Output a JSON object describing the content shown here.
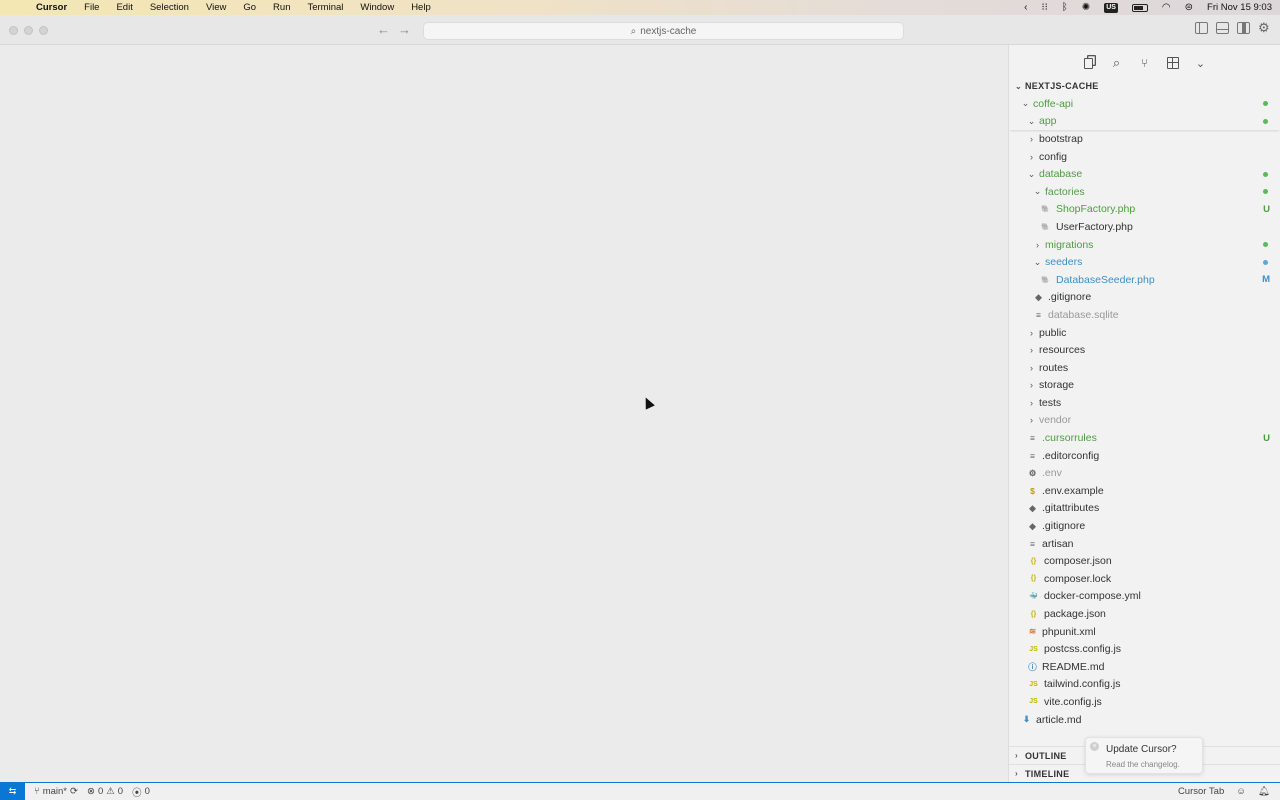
{
  "menubar": {
    "app_name": "Cursor",
    "items": [
      "File",
      "Edit",
      "Selection",
      "View",
      "Go",
      "Run",
      "Terminal",
      "Window",
      "Help"
    ],
    "input_source": "US",
    "datetime": "Fri Nov 15  9:03"
  },
  "titlebar": {
    "search_text": "nextjs-cache"
  },
  "explorer": {
    "workspace": "NEXTJS-CACHE",
    "rows": [
      {
        "label": "coffe-api",
        "depth": 1,
        "twisty": "open",
        "color": "green",
        "dot": "#5cb85c"
      },
      {
        "label": "app",
        "depth": 2,
        "twisty": "open",
        "color": "green",
        "dot": "#5cb85c"
      },
      {
        "label": "bootstrap",
        "depth": 2,
        "twisty": "closed",
        "color": "default"
      },
      {
        "label": "config",
        "depth": 2,
        "twisty": "closed",
        "color": "default"
      },
      {
        "label": "database",
        "depth": 2,
        "twisty": "open",
        "color": "green",
        "dot": "#5cb85c"
      },
      {
        "label": "factories",
        "depth": 3,
        "twisty": "open",
        "color": "green",
        "dot": "#5cb85c"
      },
      {
        "label": "ShopFactory.php",
        "depth": 4,
        "icon": "php-elephant-icon",
        "iconGlyph": "🐘",
        "color": "green",
        "badge": "U",
        "badgeColor": "#4c9e3f"
      },
      {
        "label": "UserFactory.php",
        "depth": 4,
        "icon": "php-elephant-icon",
        "iconGlyph": "🐘",
        "color": "default"
      },
      {
        "label": "migrations",
        "depth": 3,
        "twisty": "closed",
        "color": "green",
        "dot": "#5cb85c"
      },
      {
        "label": "seeders",
        "depth": 3,
        "twisty": "open",
        "color": "blue",
        "dot": "#5aa9d6"
      },
      {
        "label": "DatabaseSeeder.php",
        "depth": 4,
        "icon": "php-elephant-icon",
        "iconGlyph": "🐘",
        "color": "blue",
        "badge": "M",
        "badgeColor": "#3e8ecb"
      },
      {
        "label": ".gitignore",
        "depth": 3,
        "icon": "git-icon",
        "iconGlyph": "◆",
        "color": "default"
      },
      {
        "label": "database.sqlite",
        "depth": 3,
        "icon": "text-file-icon",
        "iconGlyph": "≡",
        "color": "gray"
      },
      {
        "label": "public",
        "depth": 2,
        "twisty": "closed",
        "color": "default"
      },
      {
        "label": "resources",
        "depth": 2,
        "twisty": "closed",
        "color": "default"
      },
      {
        "label": "routes",
        "depth": 2,
        "twisty": "closed",
        "color": "default"
      },
      {
        "label": "storage",
        "depth": 2,
        "twisty": "closed",
        "color": "default"
      },
      {
        "label": "tests",
        "depth": 2,
        "twisty": "closed",
        "color": "default"
      },
      {
        "label": "vendor",
        "depth": 2,
        "twisty": "closed",
        "color": "gray"
      },
      {
        "label": ".cursorrules",
        "depth": 2,
        "icon": "text-file-icon",
        "iconGlyph": "≡",
        "color": "green",
        "badge": "U",
        "badgeColor": "#4c9e3f"
      },
      {
        "label": ".editorconfig",
        "depth": 2,
        "icon": "text-file-icon",
        "iconGlyph": "≡",
        "color": "default"
      },
      {
        "label": ".env",
        "depth": 2,
        "icon": "gear-icon",
        "iconGlyph": "⚙",
        "color": "gray"
      },
      {
        "label": ".env.example",
        "depth": 2,
        "icon": "dollar-icon",
        "iconGlyph": "$",
        "iconColor": "#b8a000",
        "color": "default"
      },
      {
        "label": ".gitattributes",
        "depth": 2,
        "icon": "git-icon",
        "iconGlyph": "◆",
        "color": "default"
      },
      {
        "label": ".gitignore",
        "depth": 2,
        "icon": "git-icon",
        "iconGlyph": "◆",
        "color": "default"
      },
      {
        "label": "artisan",
        "depth": 2,
        "icon": "text-file-icon",
        "iconGlyph": "≡",
        "color": "default"
      },
      {
        "label": "composer.json",
        "depth": 2,
        "icon": "json-braces-icon",
        "iconGlyph": "{}",
        "iconColor": "#c9b200",
        "color": "default"
      },
      {
        "label": "composer.lock",
        "depth": 2,
        "icon": "json-braces-icon",
        "iconGlyph": "{}",
        "iconColor": "#c9b200",
        "color": "default"
      },
      {
        "label": "docker-compose.yml",
        "depth": 2,
        "icon": "docker-icon",
        "iconGlyph": "🐳",
        "iconColor": "#d6336c",
        "color": "default"
      },
      {
        "label": "package.json",
        "depth": 2,
        "icon": "json-braces-icon",
        "iconGlyph": "{}",
        "iconColor": "#c9b200",
        "color": "default"
      },
      {
        "label": "phpunit.xml",
        "depth": 2,
        "icon": "rss-icon",
        "iconGlyph": "≋",
        "iconColor": "#e8741e",
        "color": "default"
      },
      {
        "label": "postcss.config.js",
        "depth": 2,
        "icon": "js-icon",
        "iconGlyph": "JS",
        "iconColor": "#c9b200",
        "color": "default"
      },
      {
        "label": "README.md",
        "depth": 2,
        "icon": "info-icon",
        "iconGlyph": "ⓘ",
        "iconColor": "#3e8ecb",
        "color": "default"
      },
      {
        "label": "tailwind.config.js",
        "depth": 2,
        "icon": "js-icon",
        "iconGlyph": "JS",
        "iconColor": "#c9b200",
        "color": "default"
      },
      {
        "label": "vite.config.js",
        "depth": 2,
        "icon": "js-icon",
        "iconGlyph": "JS",
        "iconColor": "#c9b200",
        "color": "default"
      },
      {
        "label": "article.md",
        "depth": 1,
        "icon": "markdown-download-icon",
        "iconGlyph": "⬇",
        "iconColor": "#3e8ecb",
        "color": "default"
      }
    ],
    "outline_label": "OUTLINE",
    "timeline_label": "TIMELINE"
  },
  "toast": {
    "title": "Update Cursor?",
    "body": "Read the changelog."
  },
  "statusbar": {
    "branch": "main*",
    "errors": "0",
    "warnings": "0",
    "ports": "0",
    "cursor_tab": "Cursor Tab"
  },
  "colors": {
    "accent": "#0b77d4",
    "git_added": "#4c9e3f",
    "git_modified": "#3e8ecb"
  }
}
